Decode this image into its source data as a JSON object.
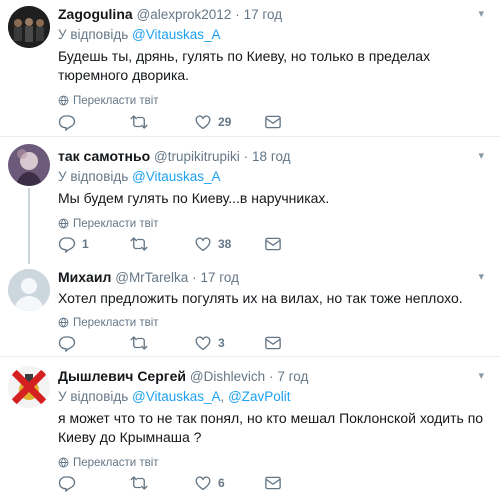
{
  "tweets": [
    {
      "name": "Zagogulina",
      "handle": "@alexprok2012",
      "dot": "·",
      "time": "17 год",
      "reply_prefix": "У відповідь ",
      "reply_to": "@Vitauskas_A",
      "reply_join": "",
      "reply_to2": "",
      "text": "Будешь ты, дрянь, гулять по Киеву, но только в пределах тюремного дворика.",
      "translate": "Перекласти твіт",
      "replies": "",
      "retweets": "",
      "likes": "29"
    },
    {
      "name": "так самотньо",
      "handle": "@trupikitrupiki",
      "dot": "·",
      "time": "18 год",
      "reply_prefix": "У відповідь ",
      "reply_to": "@Vitauskas_A",
      "reply_join": "",
      "reply_to2": "",
      "text": "Мы будем гулять по Киеву...в наручниках.",
      "translate": "Перекласти твіт",
      "replies": "1",
      "retweets": "",
      "likes": "38"
    },
    {
      "name": "Михаил",
      "handle": "@MrTarelka",
      "dot": "·",
      "time": "17 год",
      "reply_prefix": "",
      "reply_to": "",
      "reply_join": "",
      "reply_to2": "",
      "text": "Хотел предложить погулять их на вилах, но так тоже неплохо.",
      "translate": "Перекласти твіт",
      "replies": "",
      "retweets": "",
      "likes": "3"
    },
    {
      "name": "Дышлевич Сергей",
      "handle": "@Dishlevich",
      "dot": "·",
      "time": "7 год",
      "reply_prefix": "У відповідь ",
      "reply_to": "@Vitauskas_A",
      "reply_join": ", ",
      "reply_to2": "@ZavPolit",
      "text": "я может что то не так понял, но кто мешал Поклонской ходить по Киеву до Крымнаша ?",
      "translate": "Перекласти твіт",
      "replies": "",
      "retweets": "",
      "likes": "6"
    }
  ],
  "colors": {
    "link": "#1da1f2",
    "muted": "#657786",
    "divider": "#e6ecf0"
  },
  "icons": [
    "reply-icon",
    "retweet-icon",
    "like-icon",
    "direct-message-icon",
    "globe-icon",
    "chevron-down-icon"
  ]
}
